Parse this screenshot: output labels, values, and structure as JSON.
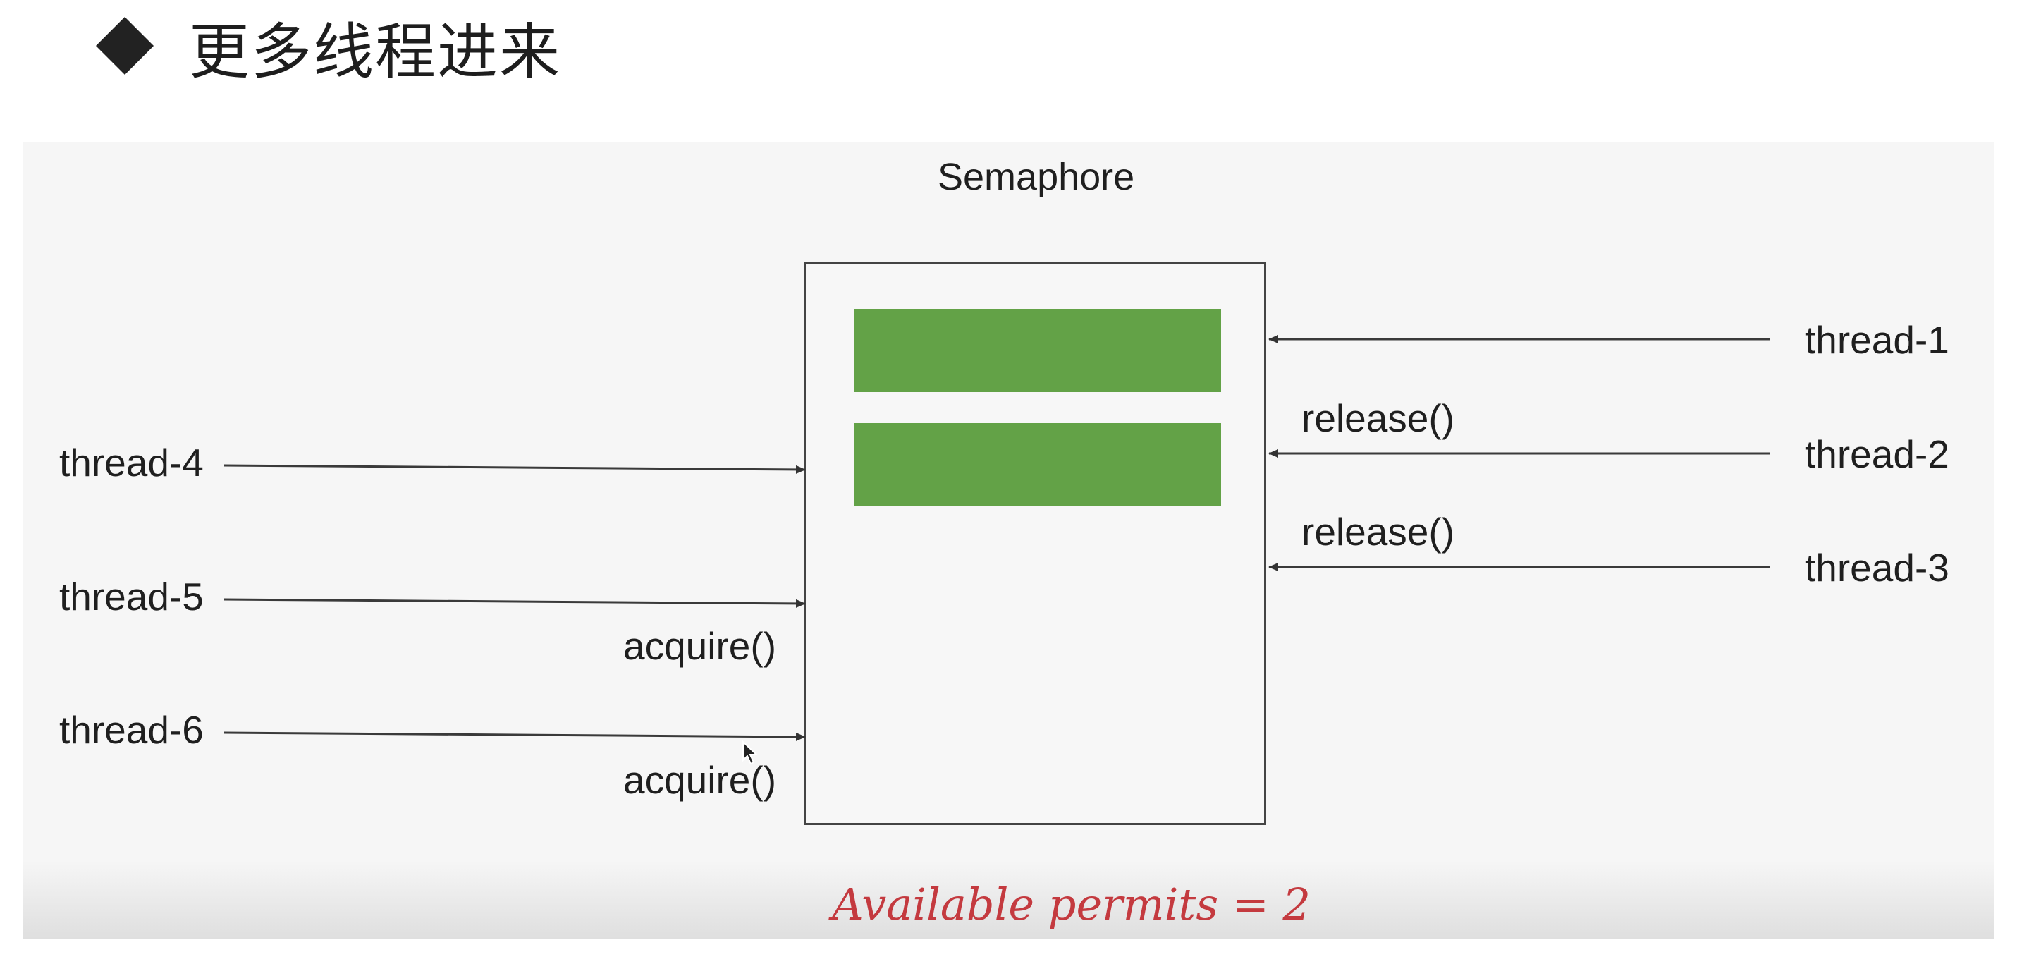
{
  "slide": {
    "title": "更多线程进来"
  },
  "diagram": {
    "semaphore_label": "Semaphore",
    "permits_held": 2,
    "permit_color": "#63a247",
    "left_threads": [
      {
        "name": "thread-4",
        "action": ""
      },
      {
        "name": "thread-5",
        "action": "acquire()"
      },
      {
        "name": "thread-6",
        "action": "acquire()"
      }
    ],
    "right_threads": [
      {
        "name": "thread-1",
        "action": ""
      },
      {
        "name": "thread-2",
        "action": "release()"
      },
      {
        "name": "thread-3",
        "action": "release()"
      }
    ],
    "available_permits_text": "Available permits = 2",
    "annotation_color": "#c43a3f"
  }
}
